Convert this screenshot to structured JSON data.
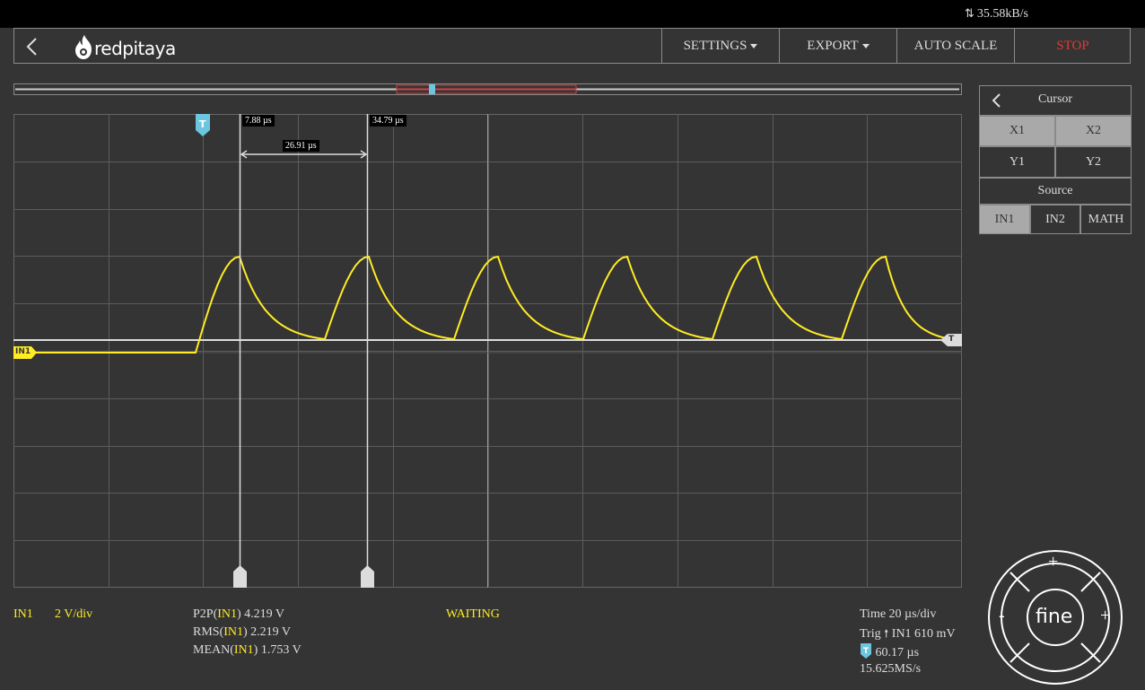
{
  "topbar": {
    "transfer_rate": "35.58kB/s",
    "icon": "upload-download-arrows-icon"
  },
  "navbar": {
    "logo_text": "redpitaya",
    "settings_label": "SETTINGS",
    "export_label": "EXPORT",
    "autoscale_label": "AUTO SCALE",
    "stop_label": "STOP",
    "stop_color": "#e53935"
  },
  "plot": {
    "trigger_marker_label": "T",
    "channel_marker_label": "IN1",
    "trigger_level_label": "T",
    "cursor_x1_label": "7.88 µs",
    "cursor_x2_label": "34.79 µs",
    "cursor_delta_label": "26.91 µs",
    "trace_color": "#ffec24",
    "trigger_color": "#6cc6e0"
  },
  "cursor_panel": {
    "title": "Cursor",
    "x1": "X1",
    "x2": "X2",
    "y1": "Y1",
    "y2": "Y2",
    "source_title": "Source",
    "source_in1": "IN1",
    "source_in2": "IN2",
    "source_math": "MATH"
  },
  "bottom": {
    "channel_name": "IN1",
    "channel_scale": "2 V/div",
    "p2p_prefix": "P2P(",
    "p2p_ch": "IN1",
    "p2p_val": ") 4.219  V",
    "rms_prefix": "RMS(",
    "rms_ch": "IN1",
    "rms_val": ") 2.219  V",
    "mean_prefix": "MEAN(",
    "mean_ch": "IN1",
    "mean_val": ") 1.753  V",
    "status": "WAITING",
    "time_label": "Time  20  µs/div",
    "trig_prefix": "Trig",
    "trig_val": "IN1 610  mV",
    "trig_offset": "60.17 µs",
    "sample_rate": "15.625MS/s"
  },
  "dpad": {
    "up": "+",
    "down": "-",
    "left": "-",
    "right": "+",
    "center": "fine"
  }
}
